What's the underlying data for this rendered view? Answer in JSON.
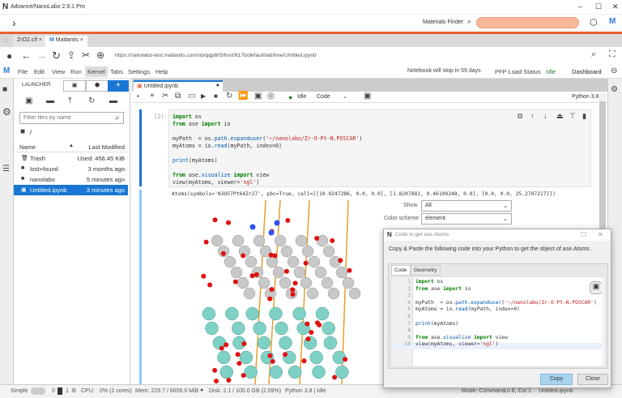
{
  "window": {
    "title": "Advance/NanoLabo 2.9.1 Pro",
    "minimize": "–",
    "maximize": "☐",
    "close": "✕"
  },
  "apptoolbar": {
    "expand": "›",
    "materials_finder_label": "Materials Finder",
    "search_value": ""
  },
  "browser_tabs": [
    {
      "label": "ZrO2.cif",
      "close": "×"
    },
    {
      "label": "Matlantis",
      "close": "×"
    }
  ],
  "nav": {
    "url": "https://nanolabo-test.matlantis.com/nb/qqp6h5ihvsi9t17b/default/lab/tree/Untitled.ipynb"
  },
  "menu": {
    "items": [
      "File",
      "Edit",
      "View",
      "Run",
      "Kernel",
      "Tabs",
      "Settings",
      "Help"
    ],
    "active": "Kernel",
    "notice": "Notebook will stop in 59 days",
    "pfp": "PFP Load Status",
    "status": "Idle",
    "dashboard": "Dashboard"
  },
  "sidebar": {
    "launcher": "LAUNCHER",
    "filter_placeholder": "Filter files by name",
    "path": "/",
    "col_name": "Name",
    "col_modified": "Last Modified",
    "files": [
      {
        "name": "Trash",
        "modified": "Used: 456.45 KiB",
        "icon": "trash-icon"
      },
      {
        "name": "lost+found",
        "modified": "3 months ago",
        "icon": "folder-icon"
      },
      {
        "name": "nanolabo",
        "modified": "5 minutes ago",
        "icon": "folder-icon"
      },
      {
        "name": "Untitled.ipynb",
        "modified": "3 minutes ago",
        "icon": "notebook-icon",
        "selected": true
      }
    ]
  },
  "notebook": {
    "tab": "Untitled.ipynb",
    "kernel_state": "Idle",
    "cell_type": "Code",
    "kernel": "Python 3.8",
    "prompt": "[2]:",
    "code": [
      "import os",
      "from ase import io",
      "",
      "myPath  = os.path.expanduser('~/nanolabo/Zr-O-Pt-N.POSCAR')",
      "myAtoms = io.read(myPath, index=0)",
      "",
      "print(myAtoms)",
      "",
      "from ase.visualize import view",
      "view(myAtoms, viewer='ngl')"
    ],
    "output": "Atoms(symbols='N3O57Pt64Zr27', pbc=True, cell=[[10.9247286, 0.0, 0.0], [1.8207881, 9.46109248, 0.0], [0.0, 0.0, 25.2797217]])",
    "show_label": "Show",
    "show_value": "All",
    "color_label": "Color scheme",
    "color_value": "element"
  },
  "dialog": {
    "title": "Code to get ase.Atoms",
    "description": "Copy & Paste the following code into your Python to get the object of ase.Atoms .",
    "tabs": [
      "Code",
      "Geometry"
    ],
    "code": [
      "import os",
      "from ase import io",
      "",
      "myPath  = os.path.expanduser('~/nanolabo/Zr-O-Pt-N.POSCAR')",
      "myAtoms = io.read(myPath, index=0)",
      "",
      "print(myAtoms)",
      "",
      "from ase.visualize import view",
      "view(myAtoms, viewer='ngl')"
    ],
    "line_numbers": [
      "1",
      "2",
      "3",
      "4",
      "5",
      "6",
      "7",
      "8",
      "9",
      "10"
    ],
    "copy": "Copy",
    "close": "Close"
  },
  "status": {
    "mode": "Simple",
    "terminals": "0",
    "kernels": "1",
    "cpu": "CPU:",
    "cpu_value": "0% (2 cores)",
    "mem": "Mem: 229.7 / 6656.0 MiB",
    "disk": "Disk: 2.1 / 100.0 GB (2.09%)",
    "kernel": "Python 3.8 | Idle",
    "mode_right": "Mode: Command",
    "cursor": "Ln 8, Col 1",
    "file": "Untitled.ipynb"
  },
  "colors": {
    "accent": "#e8622a",
    "jupyter_blue": "#1976d2",
    "search_fill": "#f9b79a",
    "pt": "#c8c8c8",
    "zr": "#7fd1c5",
    "o": "#e01010",
    "n": "#3050f8"
  }
}
